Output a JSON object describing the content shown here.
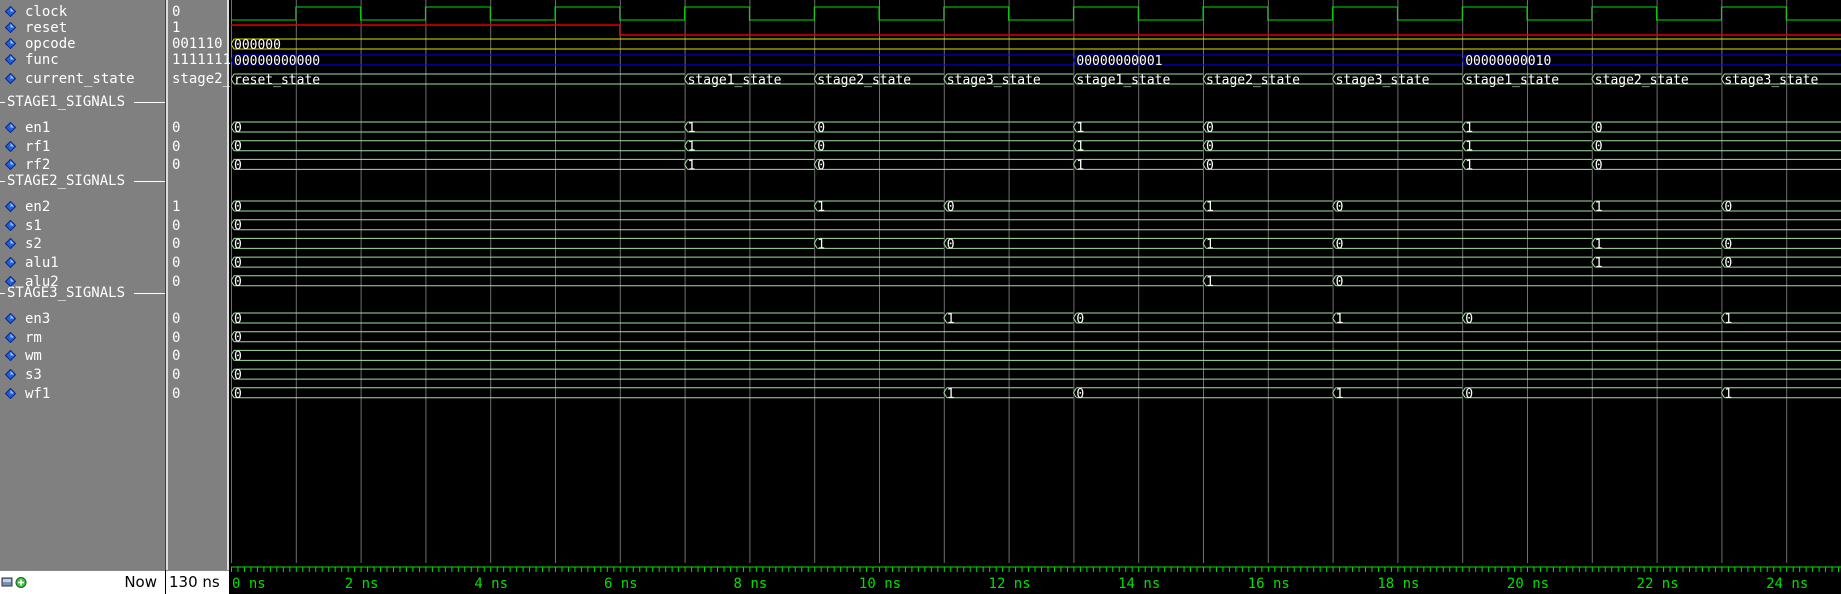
{
  "signals": [
    {
      "name": "clock",
      "value": "0",
      "color": "#00e000",
      "kind": "clock"
    },
    {
      "name": "reset",
      "value": "1",
      "color": "#e00000",
      "kind": "reset"
    },
    {
      "name": "opcode",
      "value": "001110",
      "color": "#e0e000",
      "kind": "bus",
      "segments": [
        {
          "t": 0,
          "label": "000000"
        }
      ]
    },
    {
      "name": "func",
      "value": "1111111",
      "color": "#0000ff",
      "kind": "bus",
      "segments": [
        {
          "t": 0,
          "label": "00000000000"
        },
        {
          "t": 13,
          "label": "00000000001"
        },
        {
          "t": 19,
          "label": "00000000010"
        }
      ]
    },
    {
      "name": "current_state",
      "value": "stage2_",
      "color": "#a0e0a0",
      "kind": "bus",
      "segments": [
        {
          "t": 0,
          "label": "reset_state"
        },
        {
          "t": 7,
          "label": "stage1_state"
        },
        {
          "t": 9,
          "label": "stage2_state"
        },
        {
          "t": 11,
          "label": "stage3_state"
        },
        {
          "t": 13,
          "label": "stage1_state"
        },
        {
          "t": 15,
          "label": "stage2_state"
        },
        {
          "t": 17,
          "label": "stage3_state"
        },
        {
          "t": 19,
          "label": "stage1_state"
        },
        {
          "t": 21,
          "label": "stage2_state"
        },
        {
          "t": 23,
          "label": "stage3_state"
        }
      ]
    }
  ],
  "groups": [
    {
      "title": "STAGE1_SIGNALS",
      "signals": [
        {
          "name": "en1",
          "value": "0",
          "segments": [
            {
              "t": 0,
              "label": "0"
            },
            {
              "t": 7,
              "label": "1"
            },
            {
              "t": 9,
              "label": "0"
            },
            {
              "t": 13,
              "label": "1"
            },
            {
              "t": 15,
              "label": "0"
            },
            {
              "t": 19,
              "label": "1"
            },
            {
              "t": 21,
              "label": "0"
            }
          ]
        },
        {
          "name": "rf1",
          "value": "0",
          "segments": [
            {
              "t": 0,
              "label": "0"
            },
            {
              "t": 7,
              "label": "1"
            },
            {
              "t": 9,
              "label": "0"
            },
            {
              "t": 13,
              "label": "1"
            },
            {
              "t": 15,
              "label": "0"
            },
            {
              "t": 19,
              "label": "1"
            },
            {
              "t": 21,
              "label": "0"
            }
          ]
        },
        {
          "name": "rf2",
          "value": "0",
          "segments": [
            {
              "t": 0,
              "label": "0"
            },
            {
              "t": 7,
              "label": "1"
            },
            {
              "t": 9,
              "label": "0"
            },
            {
              "t": 13,
              "label": "1"
            },
            {
              "t": 15,
              "label": "0"
            },
            {
              "t": 19,
              "label": "1"
            },
            {
              "t": 21,
              "label": "0"
            }
          ]
        }
      ]
    },
    {
      "title": "STAGE2_SIGNALS",
      "signals": [
        {
          "name": "en2",
          "value": "1",
          "segments": [
            {
              "t": 0,
              "label": "0"
            },
            {
              "t": 9,
              "label": "1"
            },
            {
              "t": 11,
              "label": "0"
            },
            {
              "t": 15,
              "label": "1"
            },
            {
              "t": 17,
              "label": "0"
            },
            {
              "t": 21,
              "label": "1"
            },
            {
              "t": 23,
              "label": "0"
            }
          ]
        },
        {
          "name": "s1",
          "value": "0",
          "segments": [
            {
              "t": 0,
              "label": "0"
            }
          ]
        },
        {
          "name": "s2",
          "value": "0",
          "segments": [
            {
              "t": 0,
              "label": "0"
            },
            {
              "t": 9,
              "label": "1"
            },
            {
              "t": 11,
              "label": "0"
            },
            {
              "t": 15,
              "label": "1"
            },
            {
              "t": 17,
              "label": "0"
            },
            {
              "t": 21,
              "label": "1"
            },
            {
              "t": 23,
              "label": "0"
            }
          ]
        },
        {
          "name": "alu1",
          "value": "0",
          "segments": [
            {
              "t": 0,
              "label": "0"
            },
            {
              "t": 21,
              "label": "1"
            },
            {
              "t": 23,
              "label": "0"
            }
          ]
        },
        {
          "name": "alu2",
          "value": "0",
          "segments": [
            {
              "t": 0,
              "label": "0"
            },
            {
              "t": 15,
              "label": "1"
            },
            {
              "t": 17,
              "label": "0"
            }
          ]
        }
      ]
    },
    {
      "title": "STAGE3_SIGNALS",
      "signals": [
        {
          "name": "en3",
          "value": "0",
          "segments": [
            {
              "t": 0,
              "label": "0"
            },
            {
              "t": 11,
              "label": "1"
            },
            {
              "t": 13,
              "label": "0"
            },
            {
              "t": 17,
              "label": "1"
            },
            {
              "t": 19,
              "label": "0"
            },
            {
              "t": 23,
              "label": "1"
            }
          ]
        },
        {
          "name": "rm",
          "value": "0",
          "segments": [
            {
              "t": 0,
              "label": "0"
            }
          ]
        },
        {
          "name": "wm",
          "value": "0",
          "segments": [
            {
              "t": 0,
              "label": "0"
            }
          ]
        },
        {
          "name": "s3",
          "value": "0",
          "segments": [
            {
              "t": 0,
              "label": "0"
            }
          ]
        },
        {
          "name": "wf1",
          "value": "0",
          "segments": [
            {
              "t": 0,
              "label": "0"
            },
            {
              "t": 11,
              "label": "1"
            },
            {
              "t": 13,
              "label": "0"
            },
            {
              "t": 17,
              "label": "1"
            },
            {
              "t": 19,
              "label": "0"
            },
            {
              "t": 23,
              "label": "1"
            }
          ]
        }
      ]
    }
  ],
  "footer": {
    "now_label": "Now",
    "now_value": "130 ns"
  },
  "timeline": {
    "ticks": [
      {
        "t": 0,
        "label": "0 ns"
      },
      {
        "t": 2,
        "label": "2 ns"
      },
      {
        "t": 4,
        "label": "4 ns"
      },
      {
        "t": 6,
        "label": "6 ns"
      },
      {
        "t": 8,
        "label": "8 ns"
      },
      {
        "t": 10,
        "label": "10 ns"
      },
      {
        "t": 12,
        "label": "12 ns"
      },
      {
        "t": 14,
        "label": "14 ns"
      },
      {
        "t": 16,
        "label": "16 ns"
      },
      {
        "t": 18,
        "label": "18 ns"
      },
      {
        "t": 20,
        "label": "20 ns"
      },
      {
        "t": 22,
        "label": "22 ns"
      },
      {
        "t": 24,
        "label": "24 ns"
      }
    ],
    "reset_release_ns": 6,
    "clock_period_ns": 2
  },
  "colors": {
    "grid": "#6e6e6e",
    "timeline": "#00e000",
    "bit_wave": "#a0e0a0",
    "diamond": "#2060e0",
    "text": "#ffffff"
  }
}
